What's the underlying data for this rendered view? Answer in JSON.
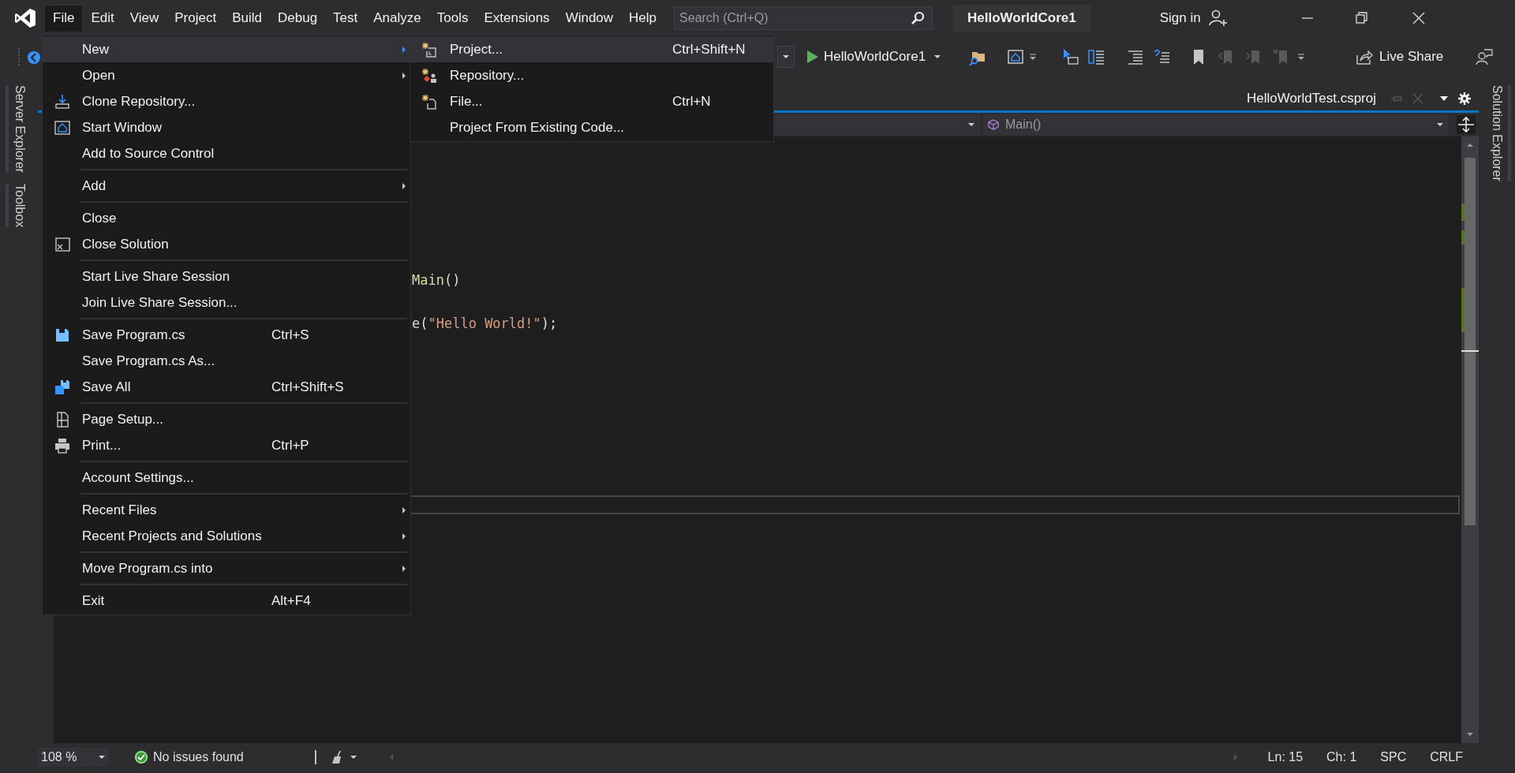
{
  "window": {
    "title": "HelloWorldCore1"
  },
  "menu_bar": [
    {
      "label": "File",
      "selected": true
    },
    {
      "label": "Edit",
      "selected": false
    },
    {
      "label": "View",
      "selected": false
    },
    {
      "label": "Project",
      "selected": false
    },
    {
      "label": "Build",
      "selected": false
    },
    {
      "label": "Debug",
      "selected": false
    },
    {
      "label": "Test",
      "selected": false
    },
    {
      "label": "Analyze",
      "selected": false
    },
    {
      "label": "Tools",
      "selected": false
    },
    {
      "label": "Extensions",
      "selected": false
    },
    {
      "label": "Window",
      "selected": false
    },
    {
      "label": "Help",
      "selected": false
    }
  ],
  "search": {
    "placeholder": "Search (Ctrl+Q)"
  },
  "account": {
    "label": "Sign in"
  },
  "toolbar": {
    "run_target": "HelloWorldCore1",
    "live_share": "Live Share"
  },
  "left_tool_tabs": [
    "Server Explorer",
    "Toolbox"
  ],
  "right_tool_tabs": [
    "Solution Explorer"
  ],
  "document": {
    "tab": "HelloWorldTest.csproj",
    "member_dropdown": "Main()"
  },
  "code_lines": [
    [
      {
        "text": "Main",
        "kind": "method"
      },
      {
        "text": "()",
        "kind": "plain"
      }
    ],
    [
      {
        "text": "e(",
        "kind": "plain"
      },
      {
        "text": "\"Hello World!\"",
        "kind": "string"
      },
      {
        "text": ");",
        "kind": "plain"
      }
    ]
  ],
  "file_menu": [
    [
      {
        "label": "New",
        "submenu": true,
        "selected": true
      },
      {
        "label": "Open",
        "submenu": true,
        "selected": false
      },
      {
        "label": "Clone Repository...",
        "submenu": false,
        "selected": false
      },
      {
        "label": "Start Window",
        "submenu": false,
        "selected": false
      },
      {
        "label": "Add to Source Control",
        "submenu": false,
        "selected": false
      }
    ],
    [
      {
        "label": "Add",
        "submenu": true,
        "selected": false
      }
    ],
    [
      {
        "label": "Close",
        "submenu": false,
        "selected": false
      },
      {
        "label": "Close Solution",
        "submenu": false,
        "selected": false
      }
    ],
    [
      {
        "label": "Start Live Share Session",
        "submenu": false,
        "selected": false
      },
      {
        "label": "Join Live Share Session...",
        "submenu": false,
        "selected": false
      }
    ],
    [
      {
        "label": "Save Program.cs",
        "shortcut": "Ctrl+S",
        "submenu": false,
        "selected": false
      },
      {
        "label": "Save Program.cs As...",
        "submenu": false,
        "selected": false
      },
      {
        "label": "Save All",
        "shortcut": "Ctrl+Shift+S",
        "submenu": false,
        "selected": false
      }
    ],
    [
      {
        "label": "Page Setup...",
        "submenu": false,
        "selected": false
      },
      {
        "label": "Print...",
        "shortcut": "Ctrl+P",
        "submenu": false,
        "selected": false
      }
    ],
    [
      {
        "label": "Account Settings...",
        "submenu": false,
        "selected": false
      }
    ],
    [
      {
        "label": "Recent Files",
        "submenu": true,
        "selected": false
      },
      {
        "label": "Recent Projects and Solutions",
        "submenu": true,
        "selected": false
      }
    ],
    [
      {
        "label": "Move Program.cs into",
        "submenu": true,
        "selected": false
      }
    ],
    [
      {
        "label": "Exit",
        "shortcut": "Alt+F4",
        "submenu": false,
        "selected": false
      }
    ]
  ],
  "new_submenu": [
    {
      "label": "Project...",
      "shortcut": "Ctrl+Shift+N",
      "selected": true
    },
    {
      "label": "Repository...",
      "selected": false
    },
    {
      "label": "File...",
      "shortcut": "Ctrl+N",
      "selected": false
    },
    {
      "label": "Project From Existing Code...",
      "selected": false
    }
  ],
  "status_bar": {
    "zoom": "108 %",
    "issues": "No issues found",
    "line": "Ln: 15",
    "column": "Ch: 1",
    "whitespace": "SPC",
    "line_ending": "CRLF"
  }
}
